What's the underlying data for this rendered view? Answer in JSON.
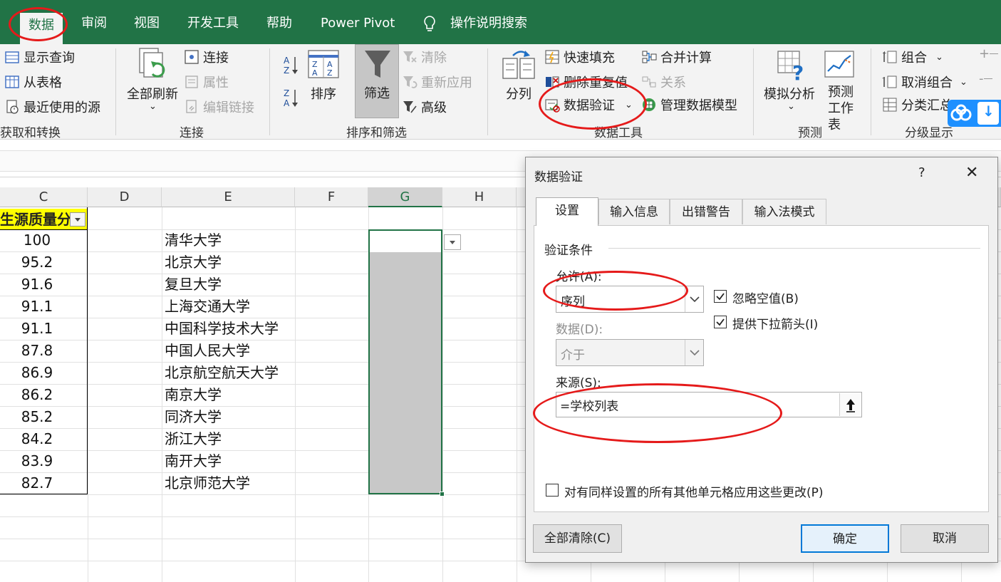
{
  "ribbon_tabs": [
    "数据",
    "审阅",
    "视图",
    "开发工具",
    "帮助",
    "Power Pivot",
    "操作说明搜索"
  ],
  "ribbon": {
    "get_transform": {
      "items": [
        "显示查询",
        "从表格",
        "最近使用的源"
      ],
      "label": "获取和转换"
    },
    "connections": {
      "refresh_all": "全部刷新",
      "items": [
        "连接",
        "属性",
        "编辑链接"
      ],
      "label": "连接"
    },
    "sort_filter": {
      "sort": "排序",
      "filter": "筛选",
      "clear": "清除",
      "reapply": "重新应用",
      "advanced": "高级",
      "label": "排序和筛选"
    },
    "data_tools": {
      "split": "分列",
      "flash_fill": "快速填充",
      "remove_dup": "删除重复值",
      "validation": "数据验证",
      "consolidate": "合并计算",
      "relations": "关系",
      "data_model": "管理数据模型",
      "label": "数据工具"
    },
    "forecast": {
      "what_if": "模拟分析",
      "sheet": "预测工作表",
      "label": "预测"
    },
    "outline": {
      "group": "组合",
      "ungroup": "取消组合",
      "subtotal": "分类汇总",
      "label": "分级显示"
    }
  },
  "columns": [
    "C",
    "D",
    "E",
    "F",
    "G",
    "H"
  ],
  "header_cell": "生源质量分",
  "rows": [
    {
      "score": "100",
      "school": "清华大学"
    },
    {
      "score": "95.2",
      "school": "北京大学"
    },
    {
      "score": "91.6",
      "school": "复旦大学"
    },
    {
      "score": "91.1",
      "school": "上海交通大学"
    },
    {
      "score": "91.1",
      "school": "中国科学技术大学"
    },
    {
      "score": "87.8",
      "school": "中国人民大学"
    },
    {
      "score": "86.9",
      "school": "北京航空航天大学"
    },
    {
      "score": "86.2",
      "school": "南京大学"
    },
    {
      "score": "85.2",
      "school": "同济大学"
    },
    {
      "score": "84.2",
      "school": "浙江大学"
    },
    {
      "score": "83.9",
      "school": "南开大学"
    },
    {
      "score": "82.7",
      "school": "北京师范大学"
    }
  ],
  "dialog": {
    "title": "数据验证",
    "help": "?",
    "close": "✕",
    "tabs": [
      "设置",
      "输入信息",
      "出错警告",
      "输入法模式"
    ],
    "section": "验证条件",
    "allow_label": "允许(A):",
    "allow_value": "序列",
    "data_label": "数据(D):",
    "data_value": "介于",
    "ignore_blank": "忽略空值(B)",
    "dropdown": "提供下拉箭头(I)",
    "source_label": "来源(S):",
    "source_value": "=学校列表",
    "apply_all": "对有同样设置的所有其他单元格应用这些更改(P)",
    "clear_all": "全部清除(C)",
    "ok": "确定",
    "cancel": "取消"
  },
  "colors": {
    "excel_green": "#217346",
    "annotation_red": "#e51a1a",
    "header_yellow": "#ffff00"
  }
}
